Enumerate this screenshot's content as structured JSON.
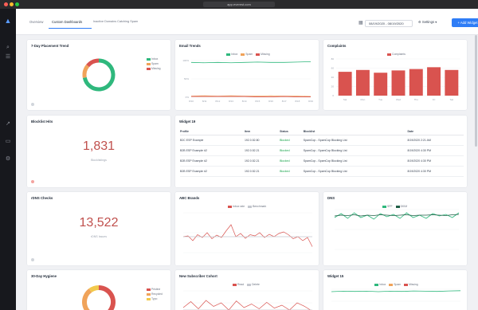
{
  "window": {
    "url": "app.everest.com",
    "traffic_lights": [
      "#ff5f57",
      "#febc2e",
      "#28c840"
    ]
  },
  "sidebar": {
    "icons": [
      "logo-icon",
      "search-icon",
      "menu-icon",
      "link-icon",
      "inbox-icon",
      "settings-icon"
    ]
  },
  "topbar": {
    "tabs": [
      {
        "label": "Overview",
        "active": false
      },
      {
        "label": "Custom Dashboards",
        "active": true
      },
      {
        "label": "Inactive Domains Catching Spam",
        "active": false
      }
    ],
    "date_range": "08/19/2020 - 08/19/2020",
    "settings_label": "Settings",
    "add_widget_label": "+ Add Widget"
  },
  "cards": {
    "placement_trend": {
      "title": "7-Day Placement Trend",
      "legend": [
        "Inbox",
        "Spam",
        "Missing"
      ]
    },
    "email_trends": {
      "title": "Email Trends",
      "legend": [
        "Inbox",
        "Spam",
        "Missing"
      ],
      "y_ticks": [
        "100%",
        "50%",
        "0%"
      ],
      "x_ticks": [
        "8/10",
        "8/11",
        "8/12",
        "8/13",
        "8/14",
        "8/15",
        "8/16",
        "8/17",
        "8/18",
        "8/19"
      ]
    },
    "complaints": {
      "title": "Complaints",
      "legend": [
        "Complaints"
      ],
      "y_ticks": [
        "80",
        "60",
        "40",
        "20",
        "0"
      ],
      "x_ticks": [
        "Sat",
        "Mon",
        "Tue",
        "Wed",
        "Thu",
        "Fri",
        "Sat"
      ]
    },
    "blocklist_hits": {
      "title": "Blocklist Hits",
      "value": "1,831",
      "caption": "Blocklistings"
    },
    "widget_19": {
      "title": "Widget 19",
      "columns": [
        "Profile",
        "Item",
        "Status",
        "Blocklist",
        "Date"
      ],
      "rows": [
        [
          "B2C ESP Example",
          "192.0.52.80",
          "Blocked",
          "SpamCop - SpamCop Blocking List",
          "8/19/2020 2:21 AM"
        ],
        [
          "B2B ESP Example #2",
          "192.0.52.21",
          "Blocked",
          "SpamCop - SpamCop Blocking List",
          "8/19/2020 4:30 PM"
        ],
        [
          "B2B ESP Example #2",
          "192.0.52.21",
          "Blocked",
          "SpamCop - SpamCop Blocking List",
          "8/19/2020 4:30 PM"
        ],
        [
          "B2B ESP Example #2",
          "192.0.52.21",
          "Blocked",
          "SpamCop - SpamCop Blocking List",
          "8/19/2020 4:30 PM"
        ]
      ]
    },
    "rdns_checks": {
      "title": "rDNS Checks",
      "value": "13,522",
      "caption": "rDNS Issues"
    },
    "abc_brands": {
      "title": "ABC Brands",
      "legend": [
        "Inbox rate",
        "Benchmark"
      ]
    },
    "dns": {
      "title": "DNS",
      "legend": [
        "SPF",
        "DKIM"
      ]
    },
    "hygiene": {
      "title": "30-Day Hygiene",
      "legend": [
        "Pristine",
        "Recycled",
        "Typo"
      ]
    },
    "subscriber_cohort": {
      "title": "New Subscriber Cohort",
      "legend": [
        "Read",
        "Delete"
      ]
    },
    "widget_15": {
      "title": "Widget 15",
      "legend": [
        "Inbox",
        "Spam",
        "Missing"
      ]
    }
  },
  "colors": {
    "green": "#2fb87d",
    "orange": "#f0a35a",
    "red": "#d9534f",
    "gray": "#c5c8cf",
    "yellow": "#f2c94c",
    "accent": "#2f7df6"
  },
  "chart_data": [
    {
      "type": "pie",
      "name": "placement_trend",
      "labels": [
        "Inbox",
        "Spam",
        "Missing"
      ],
      "values": [
        72,
        14,
        14
      ]
    },
    {
      "type": "line",
      "name": "email_trends",
      "x": [
        "8/10",
        "8/11",
        "8/12",
        "8/13",
        "8/14",
        "8/15",
        "8/16",
        "8/17",
        "8/18",
        "8/19"
      ],
      "ylim": [
        0,
        100
      ],
      "series": [
        {
          "name": "Inbox",
          "values": [
            95,
            94,
            95,
            94,
            95,
            96,
            95,
            95,
            96,
            97
          ]
        },
        {
          "name": "Spam",
          "values": [
            3,
            4,
            3,
            4,
            3,
            3,
            4,
            3,
            3,
            2
          ]
        },
        {
          "name": "Missing",
          "values": [
            2,
            2,
            2,
            2,
            2,
            1,
            1,
            2,
            1,
            1
          ]
        }
      ]
    },
    {
      "type": "bar",
      "name": "complaints",
      "categories": [
        "Sat",
        "Mon",
        "Tue",
        "Wed",
        "Thu",
        "Fri",
        "Sat"
      ],
      "values": [
        52,
        56,
        50,
        55,
        58,
        62,
        56
      ],
      "ylim": [
        0,
        80
      ]
    },
    {
      "type": "line",
      "name": "abc_brands",
      "ylim": [
        0,
        100
      ],
      "series": [
        {
          "name": "Inbox rate",
          "values": [
            40,
            42,
            30,
            45,
            38,
            50,
            35,
            44,
            38,
            55,
            70,
            40,
            48,
            36,
            45,
            42,
            50,
            38,
            46,
            40,
            48,
            52,
            45,
            35,
            40,
            30,
            38,
            15
          ]
        },
        {
          "name": "Benchmark",
          "values": [
            40,
            40,
            40,
            40,
            40,
            40,
            40,
            40,
            40,
            40,
            40,
            40,
            40,
            40,
            40,
            40,
            40,
            40,
            40,
            40,
            40,
            40,
            40,
            40,
            40,
            40,
            40,
            40
          ]
        }
      ]
    },
    {
      "type": "line",
      "name": "dns",
      "ylim": [
        0,
        100
      ],
      "series": [
        {
          "name": "SPF",
          "values": [
            80,
            90,
            78,
            92,
            80,
            86,
            76,
            90,
            82,
            88,
            78,
            92,
            80,
            86,
            78,
            90,
            84,
            88,
            80,
            92
          ]
        },
        {
          "name": "DKIM",
          "values": [
            84,
            86,
            85,
            87,
            84,
            86,
            85,
            87,
            86,
            85,
            86,
            87,
            85,
            86,
            86,
            87,
            86,
            85,
            87,
            88
          ]
        }
      ]
    },
    {
      "type": "pie",
      "name": "hygiene",
      "labels": [
        "Pristine",
        "Recycled",
        "Typo"
      ],
      "values": [
        60,
        30,
        10
      ]
    },
    {
      "type": "line",
      "name": "subscriber_cohort",
      "ylim": [
        0,
        100
      ],
      "series": [
        {
          "name": "Read",
          "values": [
            30,
            55,
            25,
            60,
            35,
            50,
            20,
            58,
            30,
            45,
            25,
            52,
            28,
            40,
            20,
            50,
            35,
            15
          ]
        },
        {
          "name": "Delete",
          "values": [
            20,
            20,
            20,
            20,
            20,
            20,
            20,
            20,
            20,
            20,
            20,
            20,
            20,
            20,
            20,
            20,
            20,
            20
          ]
        }
      ]
    },
    {
      "type": "line",
      "name": "widget_15",
      "ylim": [
        0,
        100
      ],
      "series": [
        {
          "name": "Inbox",
          "values": [
            90,
            92,
            91,
            92,
            90,
            92,
            91,
            93,
            92,
            91,
            93,
            94
          ]
        }
      ]
    }
  ]
}
